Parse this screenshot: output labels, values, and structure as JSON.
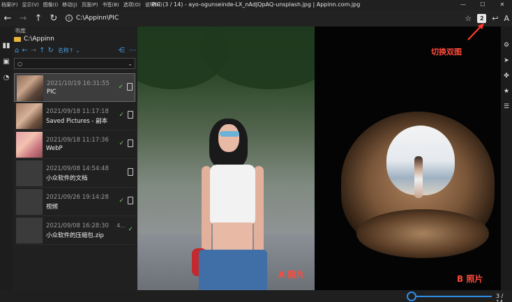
{
  "menus": [
    "档案(F)",
    "显示(V)",
    "图像(I)",
    "移动(J)",
    "页面(P)",
    "书签(B)",
    "选项(O)",
    "说明(H)"
  ],
  "window_title": "PIC (3 / 14) - ayo-ogunseinde-LX_nAdJQpAQ-unsplash.jpg | Appinn.com.jpg",
  "window_controls": {
    "minimize": "—",
    "maximize": "☐",
    "close": "✕"
  },
  "nav": {
    "back": "←",
    "forward": "→",
    "up": "↑",
    "refresh": "↻"
  },
  "address": {
    "path": "C:\\Appinn\\PIC"
  },
  "toolbar_right": {
    "star": "☆",
    "dual_view": "2",
    "back_arrow": "↩",
    "font": "A"
  },
  "activity_icons": {
    "library": "▮▮",
    "image": "▣",
    "history": "◔"
  },
  "sidebar": {
    "title": "书库",
    "path": "C:\\Appinn",
    "sort_label": "名称↑ ⌄",
    "search_placeholder": "",
    "items": [
      {
        "date": "2021/10/19 16:31:55",
        "name": "PIC",
        "check": "✓",
        "selected": true
      },
      {
        "date": "2021/09/18 11:17:18",
        "name": "Saved Pictures - 副本",
        "check": "✓"
      },
      {
        "date": "2021/09/18 11:17:36",
        "name": "WebP",
        "check": "✓"
      },
      {
        "date": "2021/09/08 14:54:48",
        "name": "小众软件的文档",
        "check": ""
      },
      {
        "date": "2021/09/26 19:14:28",
        "name": "视频",
        "check": "✓"
      },
      {
        "date": "2021/09/08 16:28:30",
        "name": "小众软件的压缩包.zip",
        "check": "✓",
        "more": "4..."
      }
    ]
  },
  "annotations": {
    "photo_a": "A 照片",
    "photo_b": "B 照片",
    "dual_view": "切换双图"
  },
  "right_icons": {
    "settings": "⚙",
    "nav": "➤",
    "pin": "✤",
    "star": "★",
    "adjust": "☰"
  },
  "page_indicator": "3 / 14",
  "colors": {
    "accent": "#2f8fe8",
    "annotation": "#ff4a3a",
    "check": "#7bd06a",
    "folder": "#e8b43a"
  }
}
